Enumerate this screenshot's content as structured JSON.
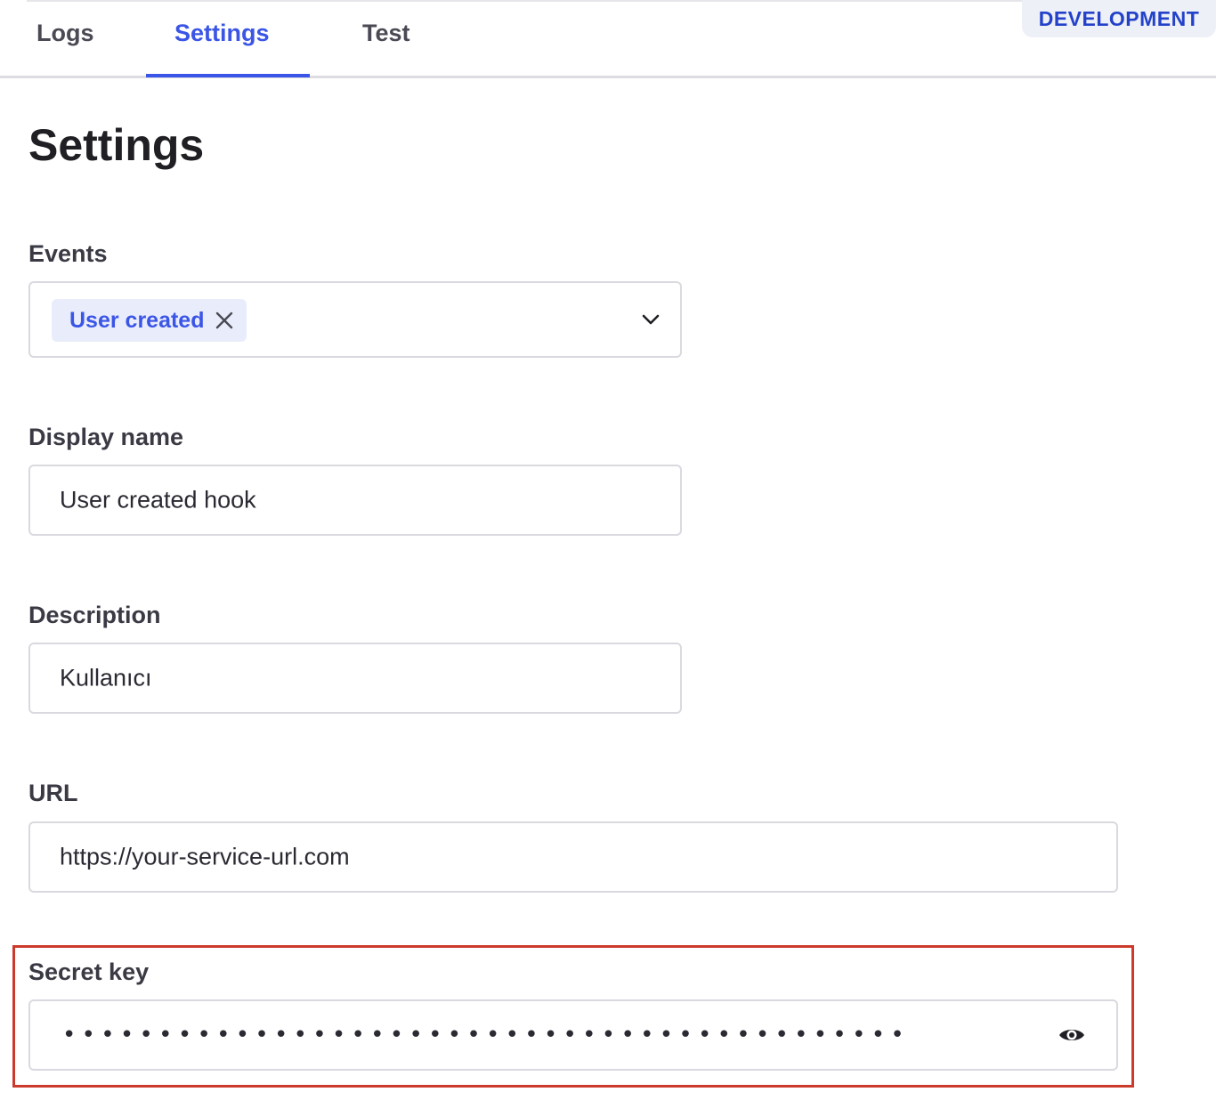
{
  "environment_badge": "DEVELOPMENT",
  "tabs": [
    {
      "label": "Logs",
      "active": false
    },
    {
      "label": "Settings",
      "active": true
    },
    {
      "label": "Test",
      "active": false
    }
  ],
  "page_title": "Settings",
  "events": {
    "label": "Events",
    "selected_chips": [
      "User created"
    ],
    "chip_remove_icon": "close-icon",
    "dropdown_icon": "chevron-down-icon"
  },
  "display_name": {
    "label": "Display name",
    "value": "User created hook"
  },
  "description": {
    "label": "Description",
    "value": "Kullanıcı"
  },
  "url": {
    "label": "URL",
    "value": "https://your-service-url.com"
  },
  "secret_key": {
    "label": "Secret key",
    "masked_value": "••••••••••••••••••••••••••••••••••••••••••••",
    "visibility_icon": "eye-icon"
  },
  "colors": {
    "accent": "#3b55e6",
    "badge_text": "#2342c9",
    "highlight": "#cc3a2b"
  }
}
